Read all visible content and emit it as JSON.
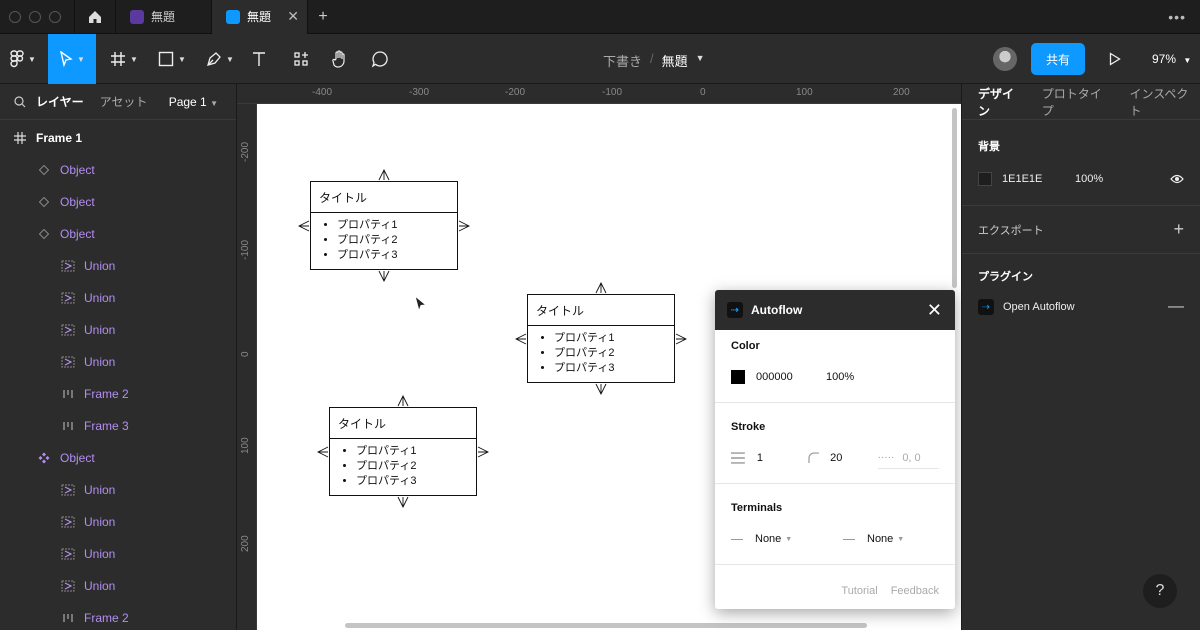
{
  "tabs": [
    {
      "label": "無題",
      "color": "#5a3a9e"
    },
    {
      "label": "無題",
      "color": "#0d99ff"
    }
  ],
  "toolbar": {
    "breadcrumb_parent": "下書き",
    "breadcrumb_sep": "/",
    "file_name": "無題",
    "share_label": "共有",
    "zoom": "97%"
  },
  "left_panel": {
    "tab_layers": "レイヤー",
    "tab_assets": "アセット",
    "page": "Page 1",
    "layers": [
      {
        "label": "Frame 1",
        "kind": "frame"
      },
      {
        "label": "Object",
        "kind": "component"
      },
      {
        "label": "Object",
        "kind": "component"
      },
      {
        "label": "Object",
        "kind": "component"
      },
      {
        "label": "Union",
        "kind": "union"
      },
      {
        "label": "Union",
        "kind": "union"
      },
      {
        "label": "Union",
        "kind": "union"
      },
      {
        "label": "Union",
        "kind": "union"
      },
      {
        "label": "Frame 2",
        "kind": "autolayout"
      },
      {
        "label": "Frame 3",
        "kind": "autolayout"
      },
      {
        "label": "Object",
        "kind": "main-component"
      },
      {
        "label": "Union",
        "kind": "union"
      },
      {
        "label": "Union",
        "kind": "union"
      },
      {
        "label": "Union",
        "kind": "union"
      },
      {
        "label": "Union",
        "kind": "union"
      },
      {
        "label": "Frame 2",
        "kind": "autolayout"
      }
    ]
  },
  "rulers": {
    "top": [
      "-400",
      "-300",
      "-200",
      "-100",
      "0",
      "100",
      "200"
    ],
    "left": [
      "-200",
      "-100",
      "0",
      "100",
      "200"
    ]
  },
  "cards": [
    {
      "title": "タイトル",
      "items": [
        "プロパティ1",
        "プロパティ2",
        "プロパティ3"
      ]
    },
    {
      "title": "タイトル",
      "items": [
        "プロパティ1",
        "プロパティ2",
        "プロパティ3"
      ]
    },
    {
      "title": "タイトル",
      "items": [
        "プロパティ1",
        "プロパティ2",
        "プロパティ3"
      ]
    }
  ],
  "plugin": {
    "name": "Autoflow",
    "color_title": "Color",
    "color_hex": "000000",
    "color_opacity": "100%",
    "stroke_title": "Stroke",
    "stroke_width": "1",
    "stroke_radius": "20",
    "stroke_dash_placeholder": "0, 0",
    "terminals_title": "Terminals",
    "terminal_start": "None",
    "terminal_end": "None",
    "tutorial": "Tutorial",
    "feedback": "Feedback"
  },
  "right_panel": {
    "tab_design": "デザイン",
    "tab_prototype": "プロトタイプ",
    "tab_inspect": "インスペクト",
    "background_title": "背景",
    "bg_hex": "1E1E1E",
    "bg_opacity": "100%",
    "export_title": "エクスポート",
    "plugins_title": "プラグイン",
    "plugin_item": "Open Autoflow"
  },
  "help": "?"
}
